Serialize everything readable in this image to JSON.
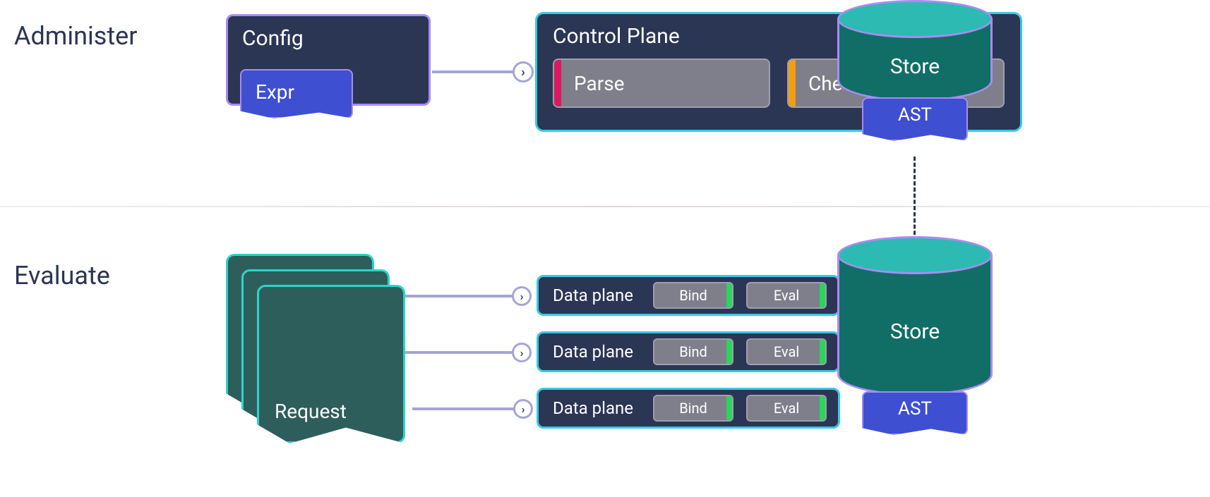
{
  "sections": {
    "administer": "Administer",
    "evaluate": "Evaluate"
  },
  "config": {
    "title": "Config",
    "expr": "Expr"
  },
  "control_plane": {
    "title": "Control Plane",
    "steps": [
      "Parse",
      "Check"
    ]
  },
  "store": {
    "label": "Store",
    "ast": "AST"
  },
  "request": {
    "label": "Request"
  },
  "data_plane": {
    "label": "Data plane",
    "steps": [
      "Bind",
      "Eval"
    ]
  },
  "colors": {
    "panel_bg": "#2b3554",
    "purple_border": "#a98cf0",
    "cyan_border": "#36c9e3",
    "teal_border": "#2cd4c8",
    "expr_bg": "#3e4fd1",
    "step_bg": "#7e7f8b",
    "parse_stripe": "#d81b60",
    "check_stripe": "#f29d12",
    "eval_stripe": "#2bd45a",
    "store_top": "#2cbab2",
    "store_body": "#116e66",
    "edge": "#a7a4d8"
  }
}
